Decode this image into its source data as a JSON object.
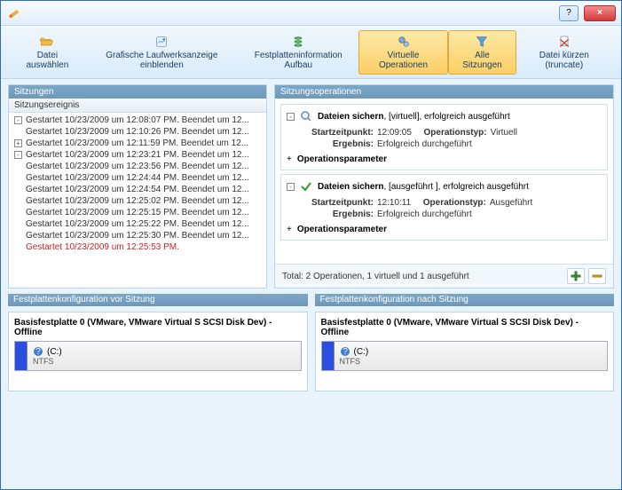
{
  "titlebar": {
    "help": "?",
    "close": "×"
  },
  "toolbar": {
    "select_file": "Datei auswählen",
    "show_drive": "Grafische Laufwerksanzeige einblenden",
    "disk_info": "Festplatteninformation Aufbau",
    "virtual_ops": "Virtuelle Operationen",
    "all_sessions": "Alle Sitzungen",
    "truncate": "Datei kürzen (truncate)"
  },
  "panels": {
    "sessions_title": "Sitzungen",
    "sessions_header": "Sitzungsereignis",
    "ops_title": "Sitzungsoperationen",
    "disk_before": "Festplattenkonfiguration vor Sitzung",
    "disk_after": "Festplattenkonfiguration nach Sitzung"
  },
  "sessions": [
    {
      "plus": "-",
      "text": "Gestartet 10/23/2009 um 12:08:07 PM. Beendet um 12..."
    },
    {
      "plus": "",
      "text": "Gestartet 10/23/2009 um 12:10:26 PM. Beendet um 12..."
    },
    {
      "plus": "+",
      "text": "Gestartet 10/23/2009 um 12:11:59 PM. Beendet um 12..."
    },
    {
      "plus": "-",
      "text": "Gestartet 10/23/2009 um 12:23:21 PM. Beendet um 12..."
    },
    {
      "plus": "",
      "text": "Gestartet 10/23/2009 um 12:23:56 PM. Beendet um 12..."
    },
    {
      "plus": "",
      "text": "Gestartet 10/23/2009 um 12:24:44 PM. Beendet um 12..."
    },
    {
      "plus": "",
      "text": "Gestartet 10/23/2009 um 12:24:54 PM. Beendet um 12..."
    },
    {
      "plus": "",
      "text": "Gestartet 10/23/2009 um 12:25:02 PM. Beendet um 12..."
    },
    {
      "plus": "",
      "text": "Gestartet 10/23/2009 um 12:25:15 PM. Beendet um 12..."
    },
    {
      "plus": "",
      "text": "Gestartet 10/23/2009 um 12:25:22 PM. Beendet um 12..."
    },
    {
      "plus": "",
      "text": "Gestartet 10/23/2009 um 12:25:30 PM. Beendet um 12..."
    },
    {
      "plus": "",
      "text": "Gestartet 10/23/2009 um 12:25:53 PM.",
      "red": true
    }
  ],
  "ops": [
    {
      "title_strong": "Dateien sichern",
      "title_rest": ", [virtuell], erfolgreich ausgeführt",
      "start_label": "Startzeitpunkt:",
      "start_value": "12:09:05",
      "type_label": "Operationstyp:",
      "type_value": "Virtuell",
      "result_label": "Ergebnis:",
      "result_value": "Erfolgreich durchgeführt",
      "params_label": "Operationsparameter",
      "icon": "shield"
    },
    {
      "title_strong": "Dateien sichern",
      "title_rest": ", [ausgeführt ], erfolgreich ausgeführt",
      "start_label": "Startzeitpunkt:",
      "start_value": "12:10:11",
      "type_label": "Operationstyp:",
      "type_value": "Ausgeführt",
      "result_label": "Ergebnis:",
      "result_value": "Erfolgreich durchgeführt",
      "params_label": "Operationsparameter",
      "icon": "check"
    }
  ],
  "total": "Total: 2 Operationen, 1 virtuell und 1 ausgeführt",
  "disks": {
    "before": {
      "title": "Basisfestplatte 0 (VMware, VMware Virtual S SCSI Disk Dev) - Offline",
      "vol_label": "(C:)",
      "vol_fs": "NTFS"
    },
    "after": {
      "title": "Basisfestplatte 0 (VMware, VMware Virtual S SCSI Disk Dev) - Offline",
      "vol_label": "(C:)",
      "vol_fs": "NTFS"
    }
  }
}
